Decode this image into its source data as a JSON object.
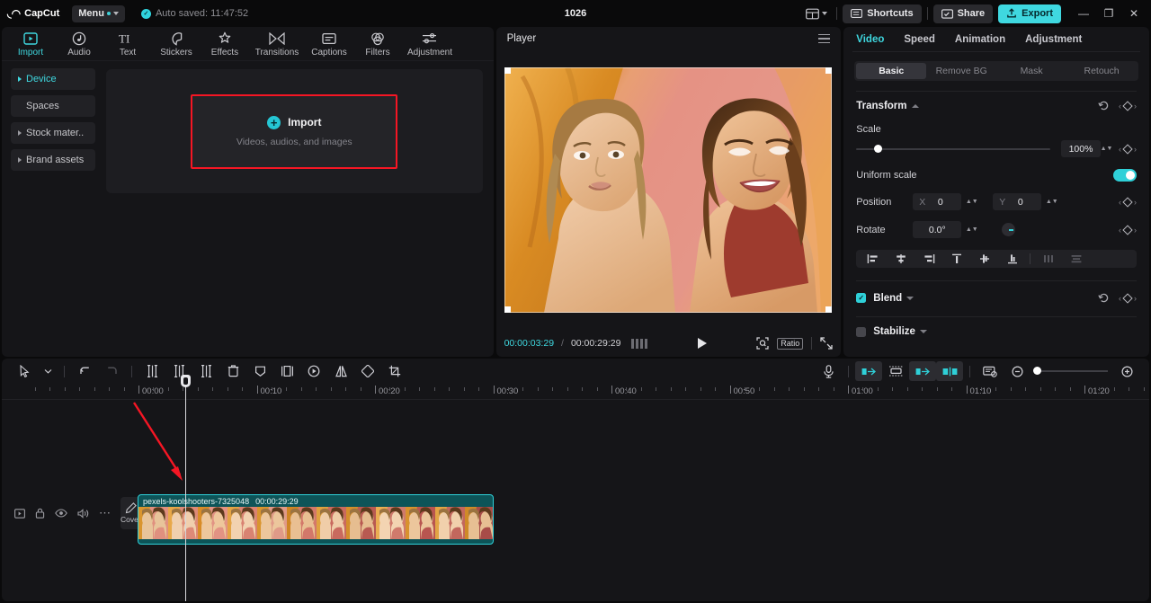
{
  "titlebar": {
    "app_name": "CapCut",
    "menu_label": "Menu",
    "autosave_text": "Auto saved: 11:47:52",
    "project_name": "1026",
    "shortcuts_label": "Shortcuts",
    "share_label": "Share",
    "export_label": "Export",
    "minimize": "—",
    "maximize": "❐",
    "close": "✕",
    "accent": "#3fd8e0"
  },
  "tool_tabs": [
    {
      "label": "Import",
      "icon": "import-icon",
      "active": true
    },
    {
      "label": "Audio",
      "icon": "audio-icon",
      "active": false
    },
    {
      "label": "Text",
      "icon": "text-icon",
      "active": false
    },
    {
      "label": "Stickers",
      "icon": "stickers-icon",
      "active": false
    },
    {
      "label": "Effects",
      "icon": "effects-icon",
      "active": false
    },
    {
      "label": "Transitions",
      "icon": "transitions-icon",
      "active": false
    },
    {
      "label": "Captions",
      "icon": "captions-icon",
      "active": false
    },
    {
      "label": "Filters",
      "icon": "filters-icon",
      "active": false
    },
    {
      "label": "Adjustment",
      "icon": "adjustment-icon",
      "active": false
    }
  ],
  "categories": [
    {
      "label": "Device",
      "expandable": true,
      "active": true
    },
    {
      "label": "Spaces",
      "expandable": false,
      "active": false
    },
    {
      "label": "Stock mater..",
      "expandable": true,
      "active": false
    },
    {
      "label": "Brand assets",
      "expandable": true,
      "active": false
    }
  ],
  "media": {
    "import_label": "Import",
    "import_sub": "Videos, audios, and images",
    "highlight_color": "#f51624"
  },
  "player": {
    "title": "Player",
    "current_time": "00:00:03:29",
    "separator": "/",
    "total_time": "00:00:29:29",
    "ratio_label": "Ratio"
  },
  "inspector": {
    "tabs": [
      {
        "label": "Video",
        "active": true
      },
      {
        "label": "Speed",
        "active": false
      },
      {
        "label": "Animation",
        "active": false
      },
      {
        "label": "Adjustment",
        "active": false
      }
    ],
    "segments": [
      {
        "label": "Basic",
        "active": true
      },
      {
        "label": "Remove BG",
        "active": false
      },
      {
        "label": "Mask",
        "active": false
      },
      {
        "label": "Retouch",
        "active": false
      }
    ],
    "transform": {
      "title": "Transform",
      "scale_label": "Scale",
      "scale_value": "100%",
      "scale_percent": 11,
      "uniform_label": "Uniform scale",
      "uniform_on": true,
      "position_label": "Position",
      "position_x_prefix": "X",
      "position_x": "0",
      "position_y_prefix": "Y",
      "position_y": "0",
      "rotate_label": "Rotate",
      "rotate_value": "0.0°"
    },
    "blend": {
      "label": "Blend",
      "checked": true
    },
    "stabilize": {
      "label": "Stabilize",
      "checked": false
    }
  },
  "timeline": {
    "ruler_labels": [
      "00:00",
      "00:10",
      "00:20",
      "00:30",
      "00:40",
      "00:50",
      "01:00",
      "01:10",
      "01:20"
    ],
    "cover_label": "Cover",
    "clip": {
      "name": "pexels-koolshooters-7325048",
      "duration": "00:00:29:29"
    },
    "zoom_value": 8
  }
}
